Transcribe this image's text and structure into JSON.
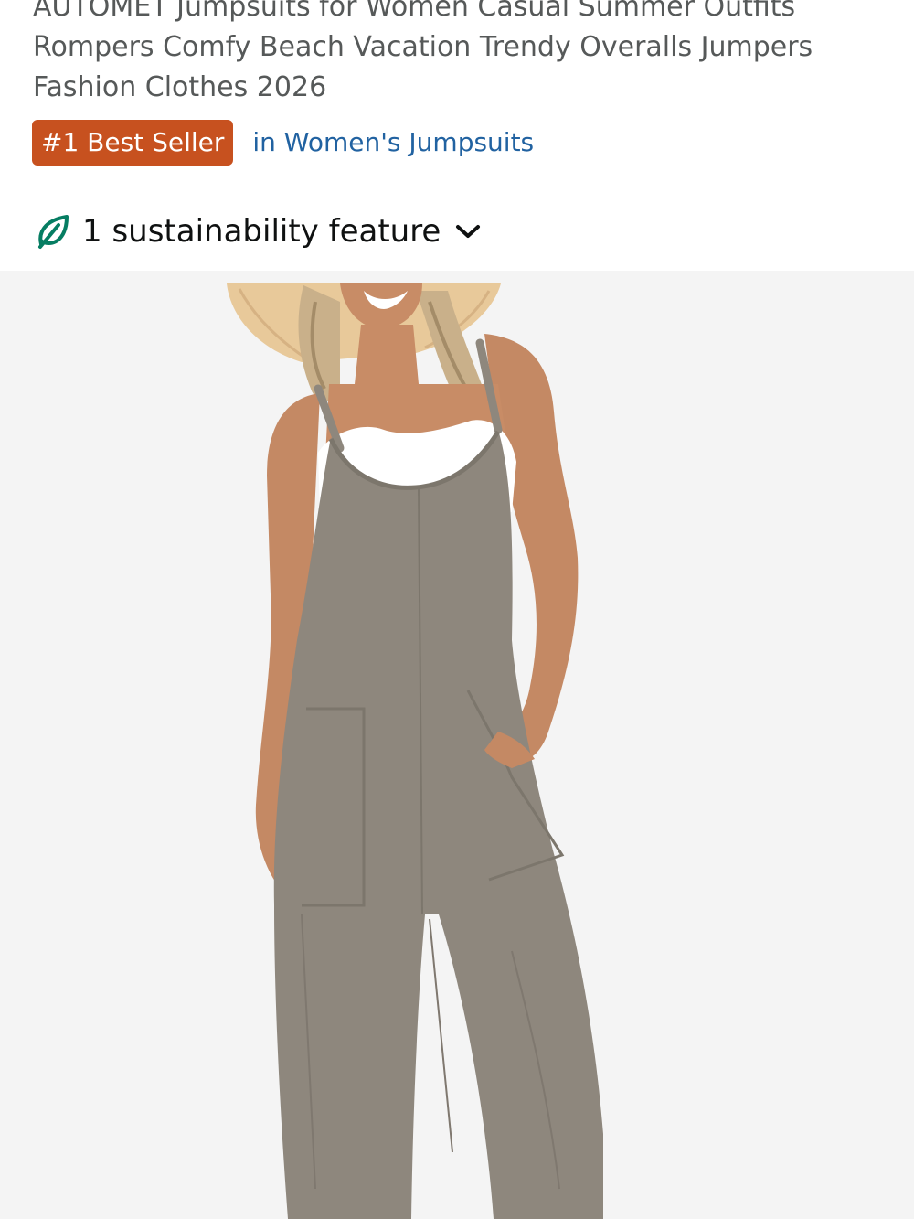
{
  "product": {
    "title": "AUTOMET Jumpsuits for Women Casual Summer Outfits Rompers Comfy Beach Vacation Trendy Overalls Jumpers Fashion Clothes 2026",
    "badge_label": "#1 Best Seller",
    "category_link": "in Women's Jumpsuits",
    "sustainability_label": "1 sustainability feature"
  },
  "icons": {
    "sustainability": "leaf-icon",
    "expand": "chevron-down-icon"
  },
  "colors": {
    "badge_bg": "#c7511f",
    "link": "#2162a1",
    "leaf": "#067d62",
    "jumpsuit": "#8e877d",
    "image_bg": "#f4f4f4"
  }
}
